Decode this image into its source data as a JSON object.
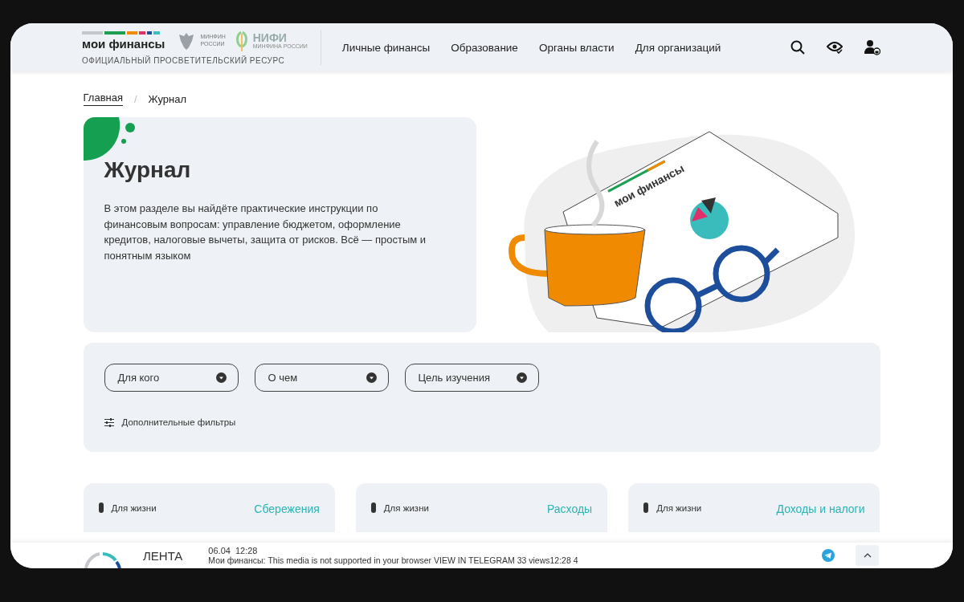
{
  "header": {
    "logo": "мои финансы",
    "tagline": "ОФИЦИАЛЬНЫЙ ПРОСВЕТИТЕЛЬСКИЙ РЕСУРС",
    "partner_1": [
      "МИНФИН",
      "РОССИИ"
    ],
    "partner_2": "НИФИ",
    "partner_2_sub": "МИНФИНА РОССИИ",
    "nav": [
      {
        "label": "Личные финансы"
      },
      {
        "label": "Образование"
      },
      {
        "label": "Органы власти"
      },
      {
        "label": "Для организаций"
      }
    ]
  },
  "breadcrumbs": [
    {
      "label": "Главная",
      "link": true
    },
    {
      "label": "Журнал",
      "link": false
    }
  ],
  "breadcrumb_separator": "/",
  "hero": {
    "title": "Журнал",
    "text": "В этом разделе вы найдёте практические инструкции по финансовым вопросам: управление бюджетом, оформление кредитов, налоговые вычеты, защита от рисков. Всё — простым и понятным языком",
    "newspaper_title": "мои финансы"
  },
  "filters": {
    "dropdowns": [
      {
        "label": "Для кого"
      },
      {
        "label": "О чем"
      },
      {
        "label": "Цель изучения"
      }
    ],
    "more": "Дополнительные фильтры"
  },
  "cards": [
    {
      "tag": "Для жизни",
      "category": "Сбережения"
    },
    {
      "tag": "Для жизни",
      "category": "Расходы"
    },
    {
      "tag": "Для жизни",
      "category": "Доходы и налоги"
    }
  ],
  "feed": {
    "label": "ЛЕНТА",
    "date": "06.04",
    "time": "12:28",
    "message": "Мои финансы: This media is not supported in your browser VIEW IN TELEGRAM 33 views12:28 4"
  }
}
